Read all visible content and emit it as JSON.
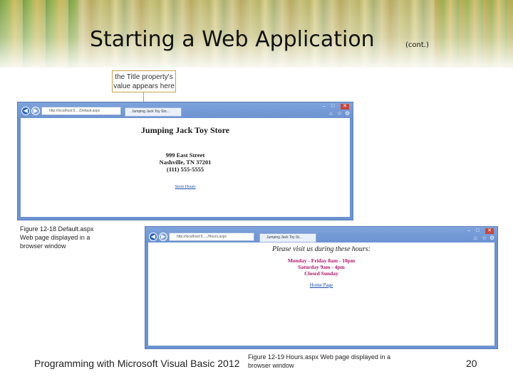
{
  "slide": {
    "title": "Starting a Web Application",
    "title_suffix": "(cont.)",
    "callout_line1": "the Title property's",
    "callout_line2": "value appears here",
    "footer": "Programming with Microsoft Visual Basic 2012",
    "page_number": "20"
  },
  "window1": {
    "address": "http://localhost:5..../Default.aspx",
    "tab_title": "Jumping Jack Toy Sto...",
    "page": {
      "heading": "Jumping Jack Toy Store",
      "address_line1": "999 East Street",
      "address_line2": "Nashville, TN 37201",
      "address_line3": "(111) 555-5555",
      "link": "Store Hours"
    },
    "caption_line1": "Figure 12-18 Default.aspx",
    "caption_line2": "Web page displayed in a",
    "caption_line3": "browser window"
  },
  "window2": {
    "address": "http://localhost:5...../Hours.aspx",
    "tab_title": "Jumping Jack Toy St...",
    "page": {
      "heading": "Please visit us during these hours:",
      "hours_line1": "Monday - Friday 8am - 10pm",
      "hours_line2": "Saturday 9am - 4pm",
      "hours_line3": "Closed Sunday",
      "link": "Home Page"
    },
    "caption_line1": "Figure 12-19 Hours.aspx Web page displayed in a",
    "caption_line2": "browser window"
  },
  "colors": {
    "window_chrome": "#6c93d1",
    "link": "#1a4db3",
    "hours_text": "#b0156a",
    "callout_border": "#c9a24a"
  }
}
